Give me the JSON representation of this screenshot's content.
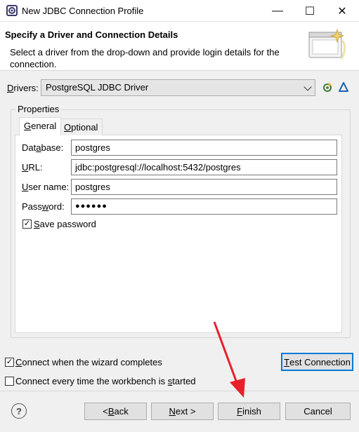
{
  "window": {
    "title": "New JDBC Connection Profile",
    "minimize_glyph": "—",
    "maximize_glyph": "☐",
    "close_glyph": "✕"
  },
  "header": {
    "title": "Specify a Driver and Connection Details",
    "description": "Select a driver from the drop-down and provide login details for the connection."
  },
  "drivers": {
    "label_prefix": "D",
    "label_rest": "rivers:",
    "selected": "PostgreSQL JDBC Driver"
  },
  "properties": {
    "group_label": "Properties",
    "tabs": [
      {
        "prefix": "G",
        "rest": "eneral"
      },
      {
        "prefix": "O",
        "rest": "ptional"
      }
    ],
    "fields": {
      "database": {
        "label_a": "Dat",
        "label_u": "a",
        "label_b": "base:",
        "value": "postgres"
      },
      "url": {
        "label_a": "",
        "label_u": "U",
        "label_b": "RL:",
        "value": "jdbc:postgresql://localhost:5432/postgres"
      },
      "user_name": {
        "label_a": "",
        "label_u": "U",
        "label_b": "ser name:",
        "value": "postgres"
      },
      "password": {
        "label_a": "Pass",
        "label_u": "w",
        "label_b": "ord:",
        "value": "●●●●●●"
      }
    },
    "save_password": {
      "label_a": "S",
      "label_b": "ave password",
      "checked": true
    }
  },
  "options": {
    "connect_on_complete": {
      "label_a": "C",
      "label_b": "onnect when the wizard completes",
      "checked": true
    },
    "connect_every_time": {
      "label_a": "Connect every time the workbench is ",
      "label_u": "s",
      "label_b": "tarted",
      "checked": false
    }
  },
  "buttons": {
    "test_connection": {
      "prefix": "T",
      "rest": "est Connection"
    },
    "back": {
      "pre": "< ",
      "u": "B",
      "rest": "ack"
    },
    "next": {
      "u": "N",
      "rest": "ext >"
    },
    "finish": {
      "u": "F",
      "rest": "inish"
    },
    "cancel": {
      "label": "Cancel"
    },
    "help_glyph": "?"
  },
  "colors": {
    "accent": "#0078d7",
    "annotation_arrow": "#e8202a"
  },
  "check_glyph": "✓"
}
